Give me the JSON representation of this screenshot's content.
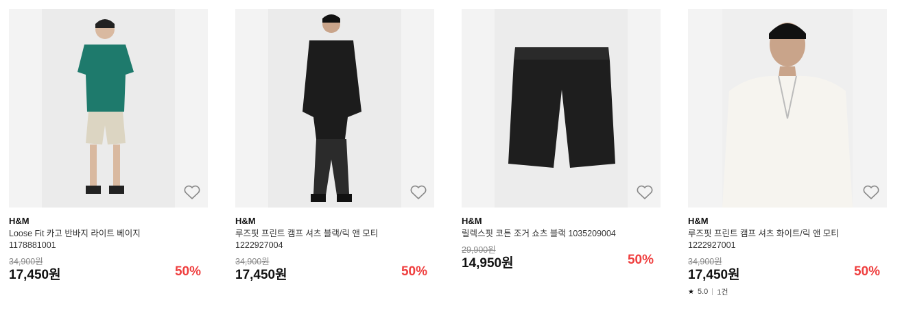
{
  "products": [
    {
      "brand": "H&M",
      "name": "Loose Fit 카고 반바지 라이트 베이지",
      "code": "1178881001",
      "original_price": "34,900원",
      "price": "17,450원",
      "discount": "50%",
      "image_icon": "tshirt-shorts-model-photo"
    },
    {
      "brand": "H&M",
      "name": "루즈핏 프린트 캠프 셔츠 블랙/릭 앤 모티",
      "code": "1222927004",
      "original_price": "34,900원",
      "price": "17,450원",
      "discount": "50%",
      "image_icon": "black-shirt-model-photo"
    },
    {
      "brand": "H&M",
      "name": "릴렉스핏 코튼 조거 쇼츠 블랙 1035209004",
      "original_price": "29,900원",
      "price": "14,950원",
      "discount": "50%",
      "image_icon": "black-shorts-photo"
    },
    {
      "brand": "H&M",
      "name": "루즈핏 프린트 캠프 셔츠 화이트/릭 앤 모티",
      "code": "1222927001",
      "original_price": "34,900원",
      "price": "17,450원",
      "discount": "50%",
      "rating": "5.0",
      "review_count": "1건",
      "image_icon": "white-shirt-model-photo"
    }
  ],
  "colors": {
    "discount": "#ef3e3e",
    "photo_bg": "#f3f3f3"
  }
}
